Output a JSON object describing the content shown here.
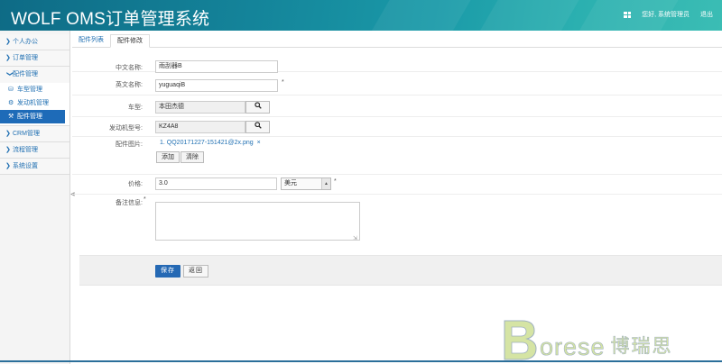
{
  "header": {
    "title": "WOLF OMS订单管理系统",
    "greeting": "您好, 系统管理员",
    "logout": "退出"
  },
  "sidebar": {
    "items": [
      {
        "label": "个人办公"
      },
      {
        "label": "订单管理"
      },
      {
        "label": "配件管理",
        "expanded": true,
        "children": [
          {
            "label": "车型管理",
            "icon": "car-icon"
          },
          {
            "label": "发动机管理",
            "icon": "engine-icon"
          },
          {
            "label": "配件管理",
            "icon": "parts-icon",
            "active": true
          }
        ]
      },
      {
        "label": "CRM管理"
      },
      {
        "label": "流程管理"
      },
      {
        "label": "系统设置"
      }
    ]
  },
  "tabs": [
    {
      "label": "配件列表",
      "active": false
    },
    {
      "label": "配件修改",
      "active": true
    }
  ],
  "form": {
    "cn_name_label": "中文名称:",
    "cn_name_value": "雨刮器B",
    "en_name_label": "英文名称:",
    "en_name_value": "yuguaqiB",
    "required_mark": "*",
    "car_label": "车型:",
    "car_value": "本田杰德",
    "engine_label": "发动机型号:",
    "engine_value": "KZ4A8",
    "image_label": "配件图片:",
    "image_file": "1. QQ20171227-151421@2x.png",
    "image_remove": "×",
    "add_label": "添加",
    "clear_label": "清除",
    "price_label": "价格:",
    "price_value": "3.0",
    "currency_value": "美元",
    "remark_label": "备注信息:",
    "remark_value": ""
  },
  "actions": {
    "save_label": "保存",
    "back_label": "返回"
  },
  "watermark": {
    "brand": "orese",
    "brand_cn": "博瑞思"
  },
  "colors": {
    "accent": "#1e6bb8",
    "header_start": "#0e6b86",
    "header_end": "#3bbdb4",
    "link": "#1f6fb2"
  }
}
